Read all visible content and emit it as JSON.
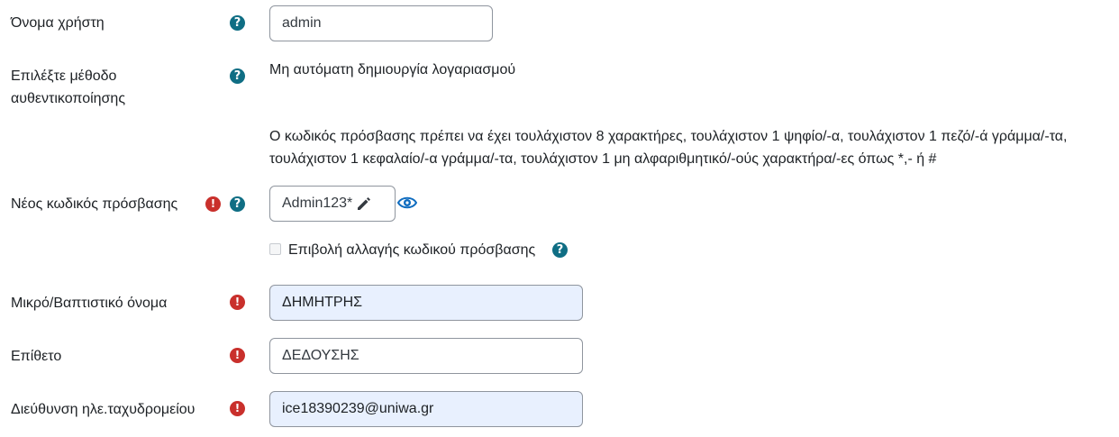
{
  "username": {
    "label": "Όνομα χρήστη",
    "value": "admin"
  },
  "auth": {
    "label": "Επιλέξτε μέθοδο αυθεντικοποίησης",
    "value": "Μη αυτόματη δημιουργία λογαριασμού"
  },
  "password_rules": "Ο κωδικός πρόσβασης πρέπει να έχει τουλάχιστον 8 χαρακτήρες, τουλάχιστον 1 ψηφίο/-α, τουλάχιστον 1 πεζό/-ά γράμμα/-τα, τουλάχιστον 1 κεφαλαίο/-α γράμμα/-τα, τουλάχιστον 1 μη αλφαριθμητικό/-ούς χαρακτήρα/-ες όπως *,- ή #",
  "new_password": {
    "label": "Νέος κωδικός πρόσβασης",
    "value": "Admin123*"
  },
  "force_change": {
    "label": "Επιβολή αλλαγής κωδικού πρόσβασης",
    "checked": false
  },
  "firstname": {
    "label": "Μικρό/Βαπτιστικό όνομα",
    "value": "ΔΗΜΗΤΡΗΣ"
  },
  "lastname": {
    "label": "Επίθετο",
    "value": "ΔΕΔΟΥΣΗΣ"
  },
  "email": {
    "label": "Διεύθυνση ηλε.ταχυδρομείου",
    "value": "ice18390239@uniwa.gr"
  },
  "icons": {
    "help": "help-icon",
    "required": "required-icon",
    "edit": "pencil-icon",
    "reveal": "eye-icon"
  },
  "colors": {
    "help": "#0f6e84",
    "required": "#c9302c",
    "eye": "#0f6cbf",
    "autofill": "#e8f0fe"
  }
}
